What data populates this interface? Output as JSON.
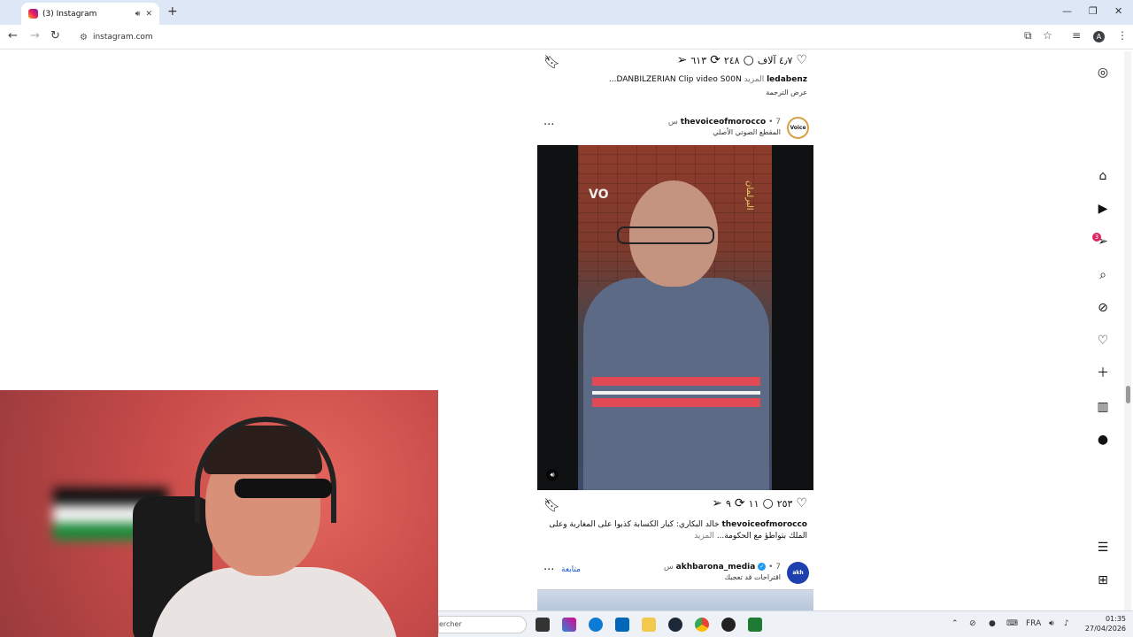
{
  "browser": {
    "tab_title": "(3) Instagram",
    "url": "instagram.com",
    "profile_initial": "A"
  },
  "post1": {
    "likes": "٤٫٧ آلاف",
    "comments": "٢٤٨",
    "reposts": "٦١٣",
    "username": "ledabenz",
    "more": "المزيد",
    "caption": "DANBILZERIAN Clip video S00N...",
    "see_translation": "عرض الترجمة"
  },
  "post2": {
    "username": "thevoiceofmorocco",
    "time": "• 7 س",
    "audio": "المقطع الصوتي الأصلي",
    "avatar_text": "Voice",
    "watermark_left": "VO",
    "watermark_right": "البرلمان",
    "likes": "٢٥٣",
    "comments": "١١",
    "reposts": "٩",
    "caption_user": "thevoiceofmorocco",
    "caption": "خالد البكاري: كبار الكسابة كذبوا على المغاربة وعلى",
    "caption2": "الملك بتواطؤ مع الحكومة...",
    "more": "المزيد"
  },
  "post3": {
    "username": "akhbarona_media",
    "time": "• 7 س",
    "suggested": "اقتراحات قد تعجبك",
    "follow": "متابعة",
    "avatar_text": "akh"
  },
  "sidebar": {
    "notifications_badge": "3"
  },
  "taskbar": {
    "search_placeholder": "ercher",
    "lang": "FRA",
    "time": "01:35",
    "date": "27/04/2026"
  },
  "colors": {
    "accent_blue": "#1a5bd6",
    "badge_red": "#e0245e"
  }
}
